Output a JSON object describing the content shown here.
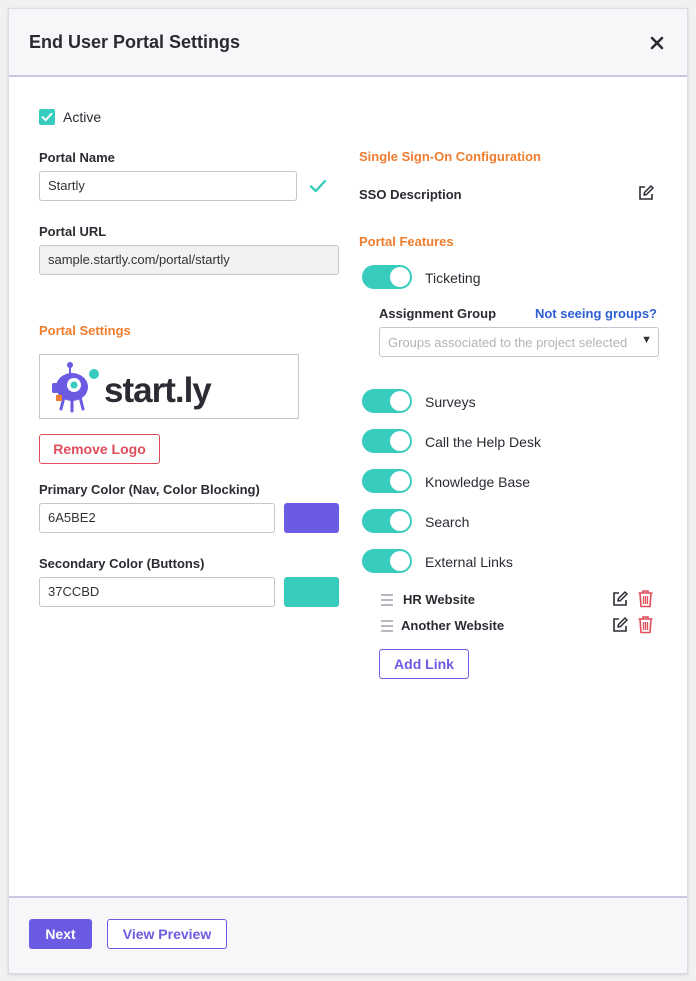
{
  "header": {
    "title": "End User Portal Settings"
  },
  "active": {
    "label": "Active",
    "checked": true
  },
  "portal_name": {
    "label": "Portal Name",
    "value": "Startly"
  },
  "portal_url": {
    "label": "Portal URL",
    "value": "sample.startly.com/portal/startly"
  },
  "portal_settings": {
    "title": "Portal Settings",
    "logo_text": "start.ly",
    "remove_logo": "Remove Logo",
    "primary": {
      "label": "Primary Color (Nav, Color Blocking)",
      "value": "6A5BE2",
      "color": "#6A5BE2"
    },
    "secondary": {
      "label": "Secondary Color (Buttons)",
      "value": "37CCBD",
      "color": "#37CCBD"
    }
  },
  "sso": {
    "title": "Single Sign-On Configuration",
    "description_label": "SSO Description"
  },
  "features": {
    "title": "Portal Features",
    "items": [
      {
        "label": "Ticketing",
        "enabled": true
      },
      {
        "label": "Surveys",
        "enabled": true
      },
      {
        "label": "Call the Help Desk",
        "enabled": true
      },
      {
        "label": "Knowledge Base",
        "enabled": true
      },
      {
        "label": "Search",
        "enabled": true
      },
      {
        "label": "External Links",
        "enabled": true
      }
    ],
    "assignment_group": {
      "label": "Assignment Group",
      "help_link": "Not seeing groups?",
      "placeholder": "Groups associated to the project selected"
    },
    "external_links": [
      "HR Website",
      "Another Website"
    ],
    "add_link": "Add Link"
  },
  "footer": {
    "next": "Next",
    "view_preview": "View Preview"
  },
  "colors": {
    "accent": "#6A5BE2",
    "teal": "#37CCBD",
    "orange": "#EF7D2E",
    "danger": "#E04C5A",
    "link": "#2E5FD4"
  }
}
